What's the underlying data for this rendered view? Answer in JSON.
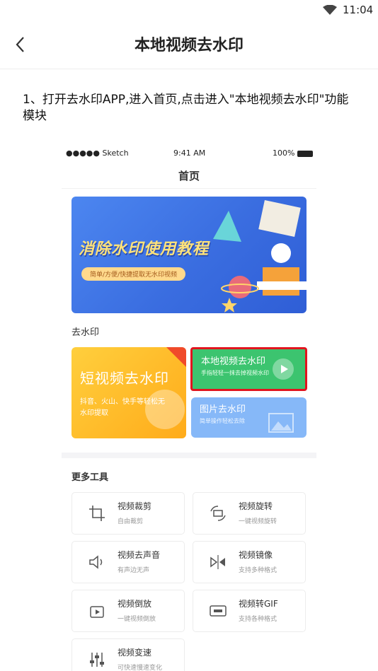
{
  "status_bar": {
    "time": "11:04"
  },
  "app_bar": {
    "title": "本地视频去水印"
  },
  "step": {
    "text": "1、打开去水印APP,进入首页,点击进入\"本地视频去水印\"功能模块"
  },
  "phone": {
    "status": {
      "carrier": "●●●●● Sketch",
      "time": "9:41 AM",
      "battery": "100%"
    },
    "page_title": "首页",
    "banner": {
      "title": "消除水印使用教程",
      "pill": "简单/方便/快捷提取无水印视频"
    },
    "section_remove": "去水印",
    "card_short": {
      "title": "短视频去水印",
      "desc": "抖音、火山、快手等轻松无水印提取"
    },
    "card_local": {
      "title": "本地视频去水印",
      "desc": "手指轻轻一抹去掉视频水印"
    },
    "card_image": {
      "title": "图片去水印",
      "desc": "简单操作轻松去除"
    },
    "section_more": "更多工具",
    "tools": [
      {
        "name": "视频裁剪",
        "desc": "自由裁剪",
        "icon": "crop-icon"
      },
      {
        "name": "视频旋转",
        "desc": "一键视频旋转",
        "icon": "rotate-icon"
      },
      {
        "name": "视频去声音",
        "desc": "有声边无声",
        "icon": "mute-icon"
      },
      {
        "name": "视频镜像",
        "desc": "支持多种格式",
        "icon": "mirror-icon"
      },
      {
        "name": "视频倒放",
        "desc": "一键视频倒放",
        "icon": "reverse-icon"
      },
      {
        "name": "视频转GIF",
        "desc": "支持各种格式",
        "icon": "gif-icon"
      },
      {
        "name": "视频变速",
        "desc": "可快速慢速变化",
        "icon": "speed-icon"
      }
    ]
  }
}
